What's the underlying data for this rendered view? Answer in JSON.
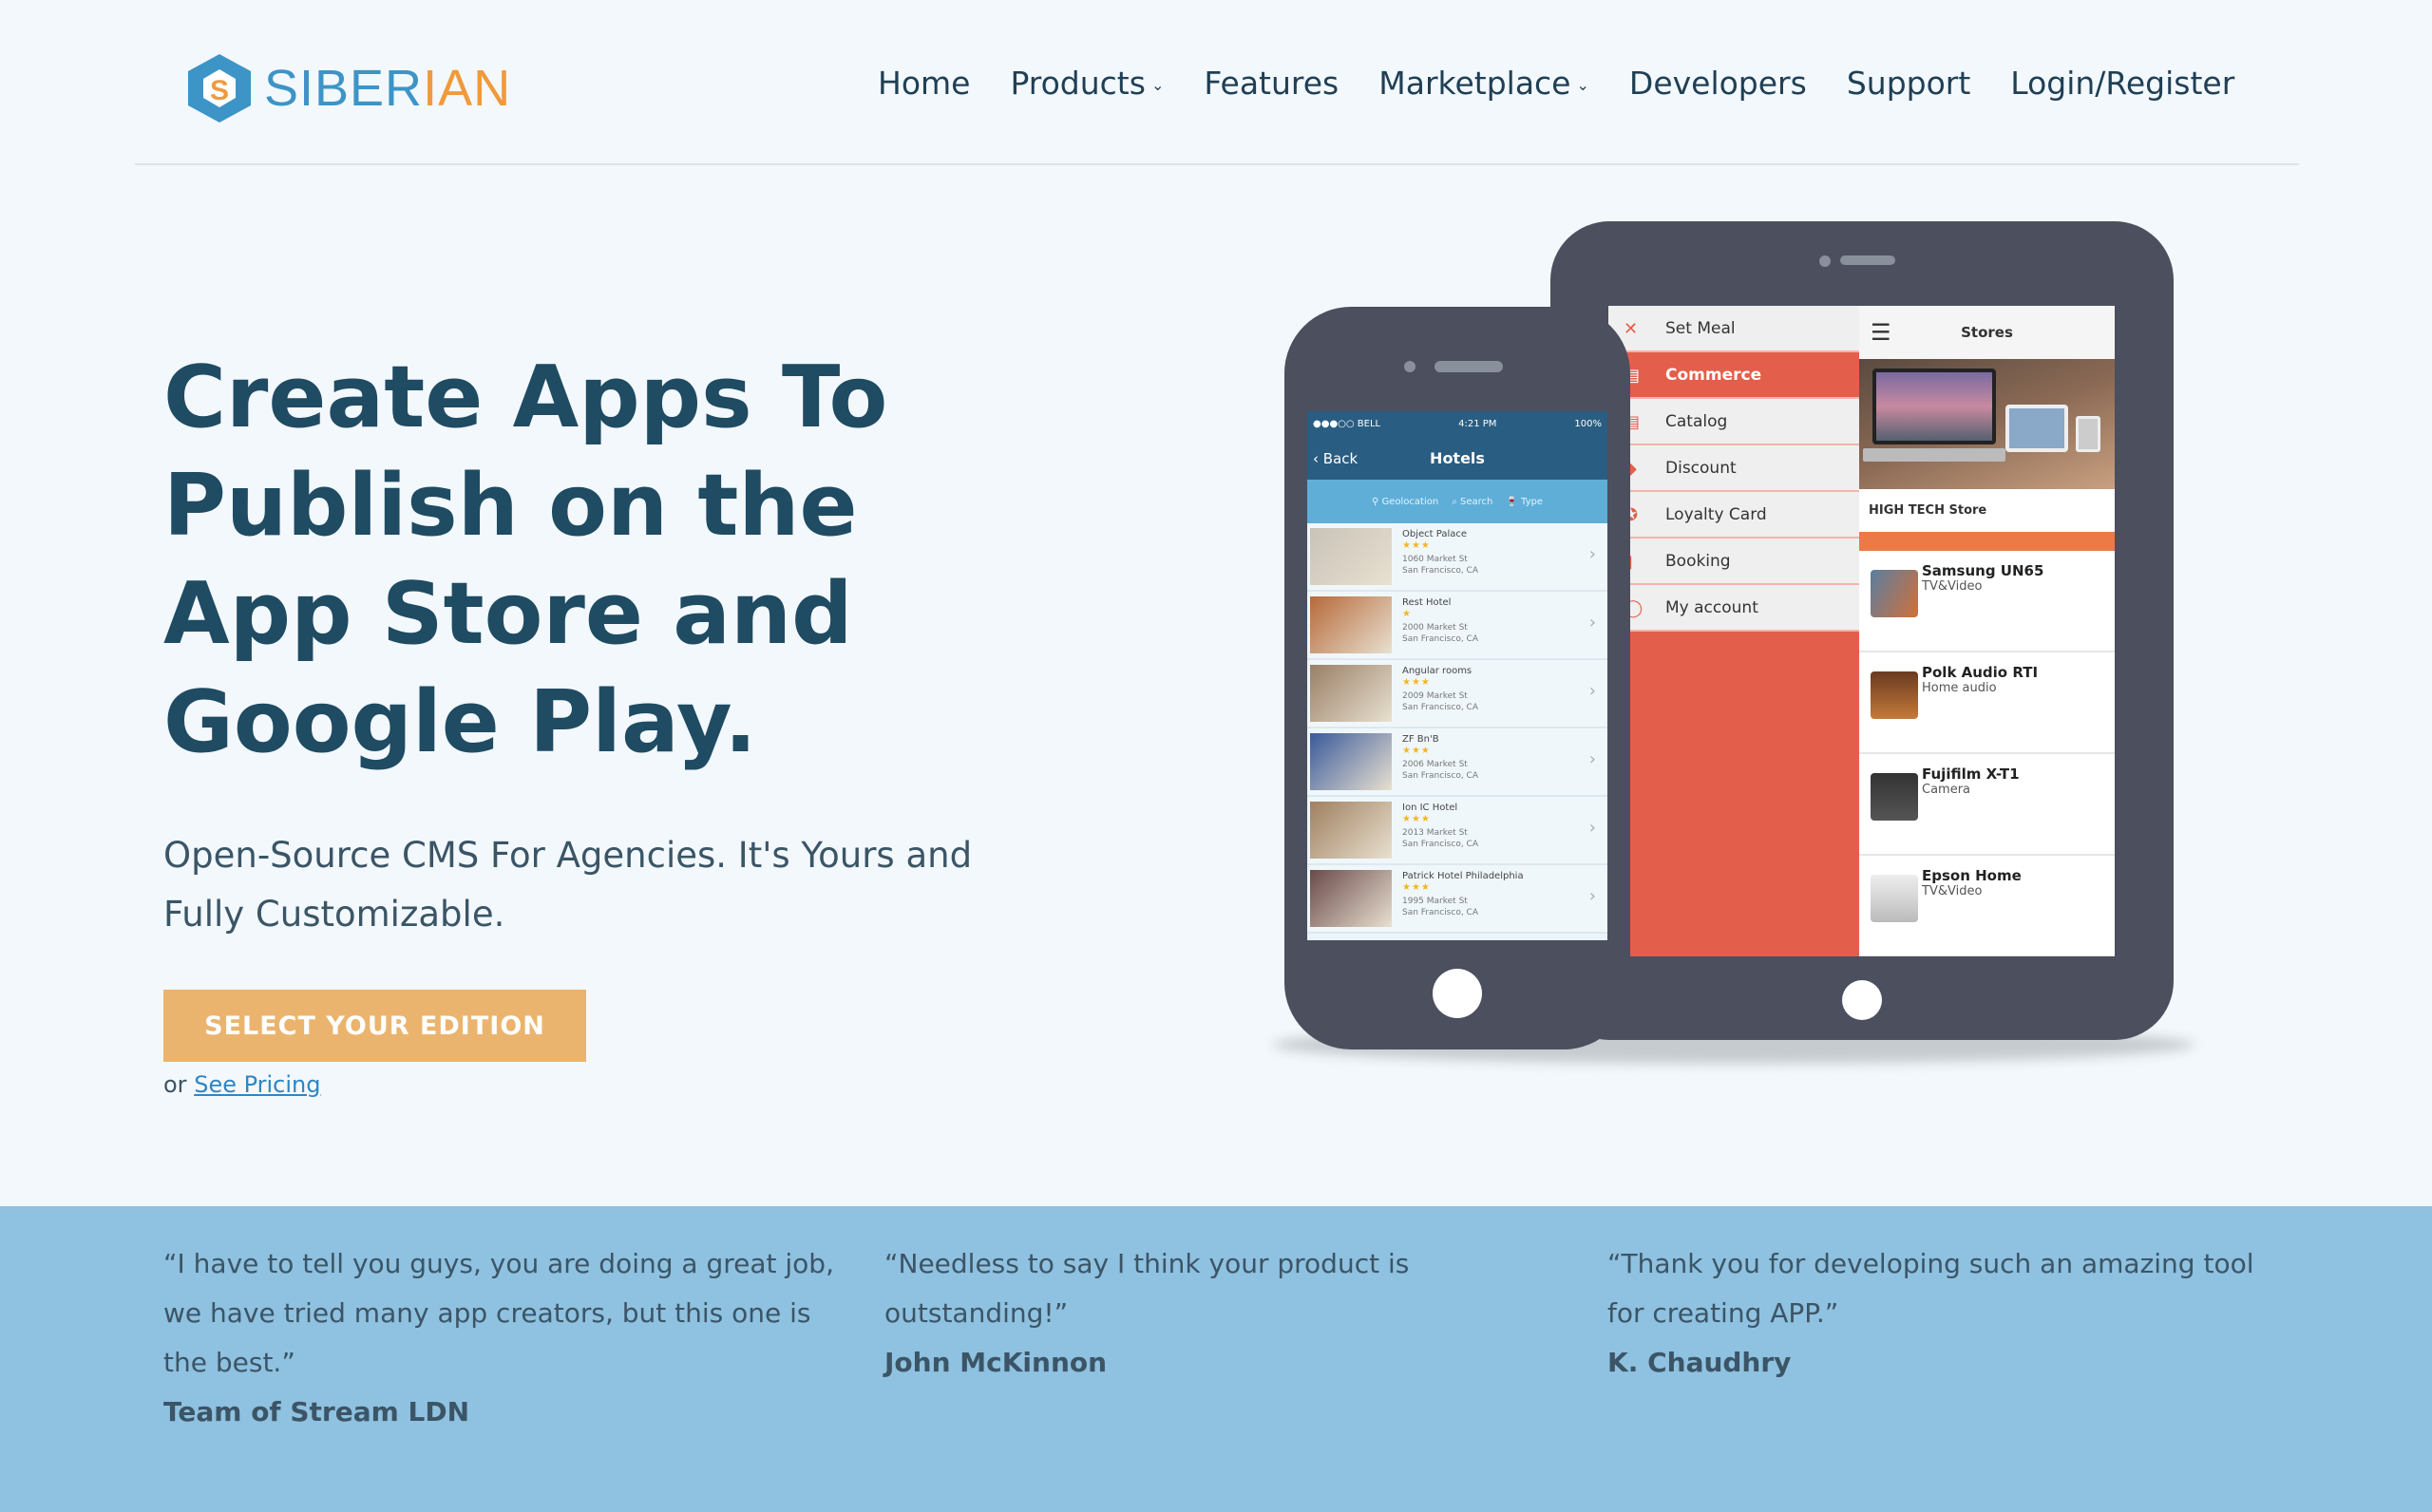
{
  "header": {
    "logo": {
      "part1": "SIBER",
      "part2": "IAN"
    },
    "nav": [
      {
        "label": "Home"
      },
      {
        "label": "Products",
        "dropdown": true
      },
      {
        "label": "Features"
      },
      {
        "label": "Marketplace",
        "dropdown": true
      },
      {
        "label": "Developers"
      },
      {
        "label": "Support"
      },
      {
        "label": "Login/Register"
      }
    ]
  },
  "hero": {
    "title": "Create Apps To Publish on the App Store and Google Play.",
    "subtitle": "Open-Source CMS For Agencies. It's Yours and Fully Customizable.",
    "cta": "SELECT YOUR EDITION",
    "or": "or",
    "pricing_link": "See Pricing"
  },
  "tablet": {
    "menu": [
      {
        "label": "Set Meal",
        "icon": "cutlery-icon"
      },
      {
        "label": "Commerce",
        "icon": "book-icon",
        "active": true
      },
      {
        "label": "Catalog",
        "icon": "book-icon"
      },
      {
        "label": "Discount",
        "icon": "tag-icon"
      },
      {
        "label": "Loyalty Card",
        "icon": "badge-icon"
      },
      {
        "label": "Booking",
        "icon": "booking-icon"
      },
      {
        "label": "My account",
        "icon": "user-icon"
      }
    ],
    "panel_title": "Stores",
    "store_name": "HIGH TECH Store",
    "products": [
      {
        "name": "Samsung UN65",
        "category": "TV&Video"
      },
      {
        "name": "Polk Audio RTI",
        "category": "Home audio"
      },
      {
        "name": "Fujifilm X-T1",
        "category": "Camera"
      },
      {
        "name": "Epson Home",
        "category": "TV&Video"
      }
    ]
  },
  "phone": {
    "carrier": "●●●○○ BELL",
    "time": "4:21 PM",
    "battery": "100%",
    "back": "Back",
    "title": "Hotels",
    "filters": [
      "Geolocation",
      "Search",
      "Type"
    ],
    "hotels": [
      {
        "name": "Object Palace",
        "stars": "★★★",
        "street": "1060 Market St",
        "city": "San Francisco, CA"
      },
      {
        "name": "Rest Hotel",
        "stars": "★",
        "street": "2000 Market St",
        "city": "San Francisco, CA"
      },
      {
        "name": "Angular rooms",
        "stars": "★★★",
        "street": "2009 Market St",
        "city": "San Francisco, CA"
      },
      {
        "name": "ZF Bn'B",
        "stars": "★★★",
        "street": "2006 Market St",
        "city": "San Francisco, CA"
      },
      {
        "name": "Ion IC Hotel",
        "stars": "★★★",
        "street": "2013 Market St",
        "city": "San Francisco, CA"
      },
      {
        "name": "Patrick Hotel Philadelphia",
        "stars": "★★★",
        "street": "1995 Market St",
        "city": "San Francisco, CA"
      }
    ]
  },
  "testimonials": [
    {
      "quote": "“I have to tell you guys, you are doing a great job, we have tried many app creators, but this one is the best.”",
      "author": "Team of Stream LDN"
    },
    {
      "quote": "“Needless to say I think your product is outstanding!”",
      "author": "John McKinnon"
    },
    {
      "quote": "“Thank you for developing such an amazing tool for creating APP.”",
      "author": "K. Chaudhry"
    }
  ],
  "colors": {
    "brand_blue": "#3d94c6",
    "brand_orange": "#ef9a3c",
    "cta": "#ebb46e",
    "band": "#8fc1e0",
    "heading": "#1f4b63"
  }
}
